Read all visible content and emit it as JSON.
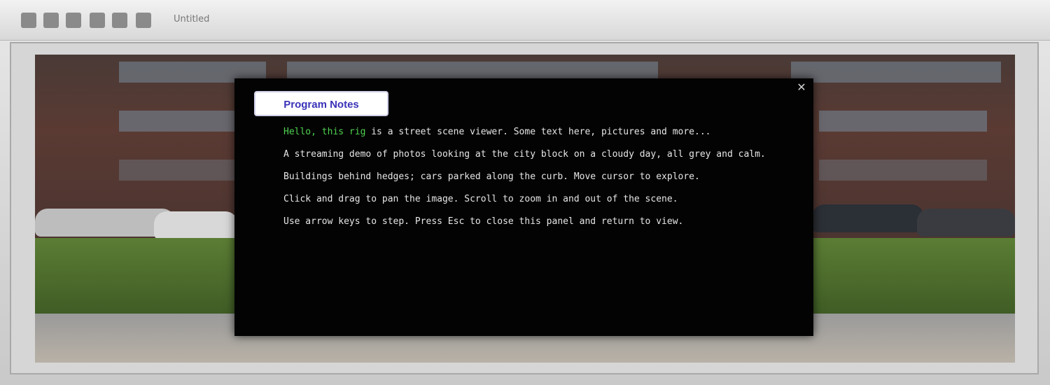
{
  "toolbar": {
    "buttons": [
      "tool-1",
      "tool-2",
      "tool-3",
      "tool-4",
      "tool-5",
      "tool-6"
    ],
    "label": "Untitled"
  },
  "dialog": {
    "title_button": "Program Notes",
    "close_label": "✕",
    "lines": [
      {
        "prefix": "",
        "highlight": "Hello, this rig",
        "rest": " is a street scene viewer. Some text here, pictures and more..."
      },
      {
        "prefix": "",
        "highlight": "",
        "rest": "A streaming demo of photos looking at the city block on a cloudy day, all grey and calm."
      },
      {
        "prefix": "",
        "highlight": "",
        "rest": "Buildings behind hedges; cars parked along the curb. Move cursor to explore."
      },
      {
        "prefix": "",
        "highlight": "",
        "rest": "Click and drag to pan the image. Scroll to zoom in and out of the scene."
      },
      {
        "prefix": "",
        "highlight": "",
        "rest": "Use arrow keys to step. Press Esc to close this panel and return to view."
      }
    ]
  },
  "colors": {
    "accent_green": "#4fd24f",
    "title_blue": "#3a32b8",
    "dialog_bg": "#030303"
  }
}
